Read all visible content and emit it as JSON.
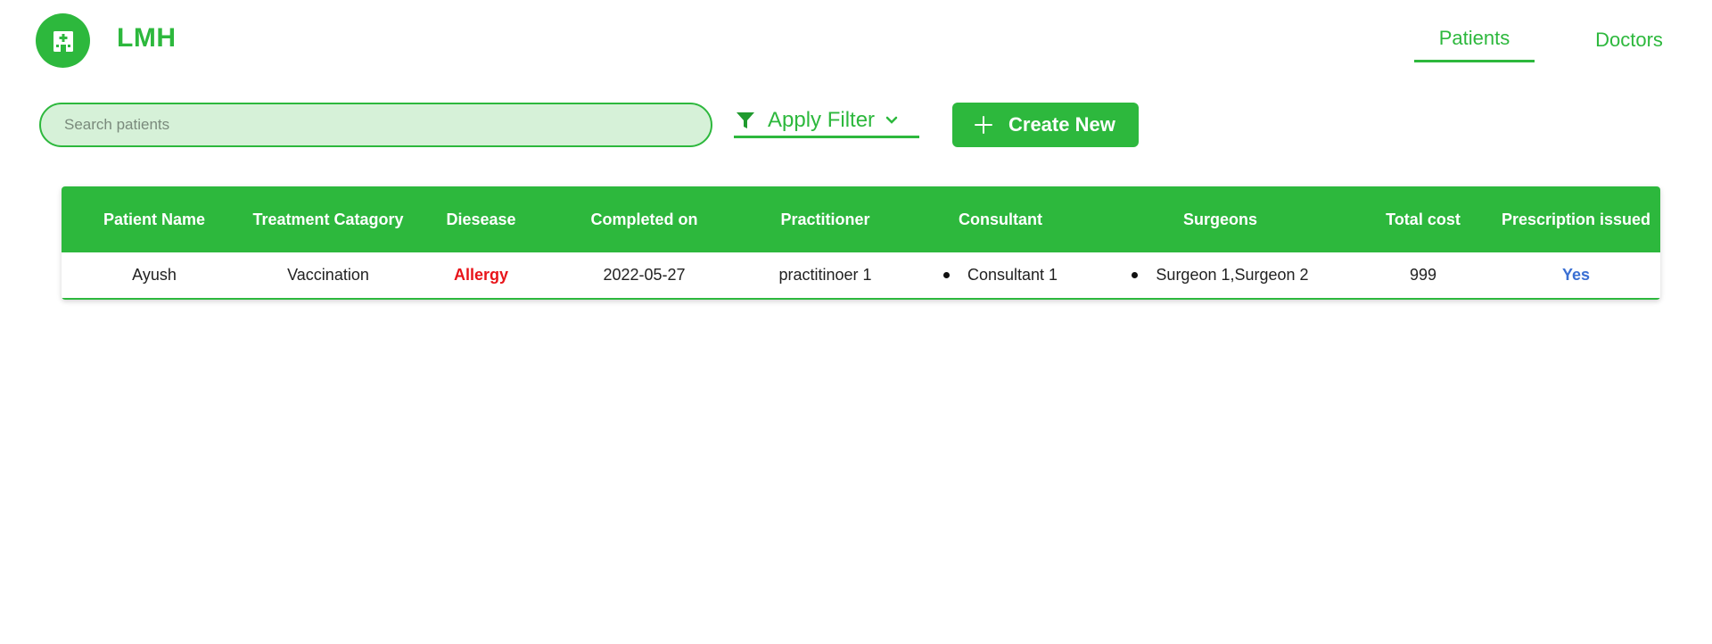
{
  "header": {
    "brand": "LMH",
    "logo_icon": "hospital-icon",
    "tabs": [
      {
        "label": "Patients",
        "active": true
      },
      {
        "label": "Doctors",
        "active": false
      }
    ]
  },
  "toolbar": {
    "search_placeholder": "Search patients",
    "search_value": "",
    "filter_label": "Apply Filter",
    "filter_icon": "filter-icon",
    "create_label": "Create New",
    "create_icon": "plus-icon"
  },
  "table": {
    "columns": [
      "Patient Name",
      "Treatment Catagory",
      "Diesease",
      "Completed on",
      "Practitioner",
      "Consultant",
      "Surgeons",
      "Total cost",
      "Prescription issued"
    ],
    "rows": [
      {
        "patient_name": "Ayush",
        "treatment_category": "Vaccination",
        "disease": "Allergy",
        "completed_on": "2022-05-27",
        "practitioner": "practitinoer 1",
        "consultant": "Consultant 1",
        "surgeons": "Surgeon 1,Surgeon 2",
        "total_cost": "999",
        "prescription_issued": "Yes"
      }
    ]
  },
  "colors": {
    "accent": "#2db83d",
    "search_bg": "#d6f1d8",
    "disease": "#e8141a",
    "yes": "#3a6fd3"
  }
}
